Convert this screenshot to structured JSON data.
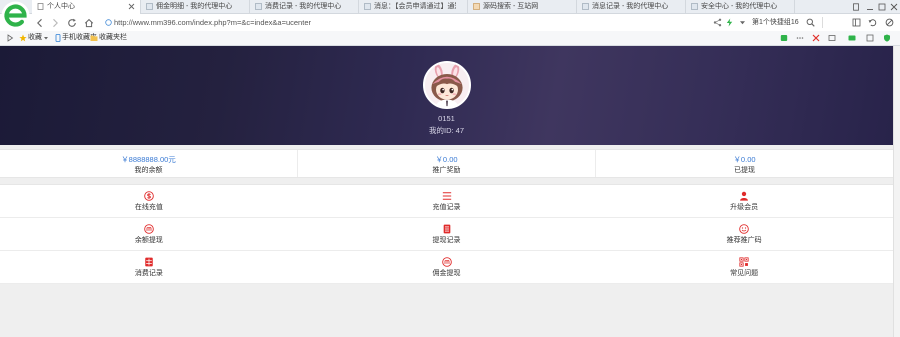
{
  "browser": {
    "tabs": [
      {
        "label": "个人中心",
        "favicon": "page-icon",
        "active": true
      },
      {
        "label": "佣金明细 - 我的代理中心",
        "favicon": "site-icon"
      },
      {
        "label": "消费记录 - 我的代理中心",
        "favicon": "site-icon"
      },
      {
        "label": "消息：【会员申请通过】通知：您",
        "favicon": "site-icon"
      },
      {
        "label": "源码搜索 - 互站网",
        "favicon": "site-icon"
      },
      {
        "label": "消息记录 - 我的代理中心",
        "favicon": "site-icon"
      },
      {
        "label": "安全中心 - 我的代理中心",
        "favicon": "site-icon"
      }
    ],
    "address": {
      "url": "http://www.mm396.com/index.php?m=&c=index&a=ucenter"
    },
    "search_hint": "第1个快捷组16",
    "bookmarks": {
      "favorites_label": "收藏",
      "mobile_label": "手机收藏夹",
      "bar_label": "收藏夹栏"
    }
  },
  "profile": {
    "avatar": "cartoon-girl-avatar",
    "nickname": "0151",
    "id_text": "我的ID: 47"
  },
  "stats": [
    {
      "value": "￥8888888.00元",
      "label": "我的余额"
    },
    {
      "value": "￥0.00",
      "label": "推广奖励"
    },
    {
      "value": "￥0.00",
      "label": "已提现"
    }
  ],
  "menu": [
    {
      "label": "在线充值",
      "icon": "dollar-circle-icon"
    },
    {
      "label": "充值记录",
      "icon": "list-icon"
    },
    {
      "label": "升级会员",
      "icon": "user-icon"
    },
    {
      "label": "余额提现",
      "icon": "m-circle-icon"
    },
    {
      "label": "提现记录",
      "icon": "document-icon"
    },
    {
      "label": "推荐推广码",
      "icon": "smile-icon"
    },
    {
      "label": "消费记录",
      "icon": "grid-document-icon"
    },
    {
      "label": "佣金提现",
      "icon": "m-circle-icon"
    },
    {
      "label": "常见问题",
      "icon": "qr-code-icon"
    }
  ],
  "colors": {
    "banner_dark": "#1b1a37",
    "banner_light": "#3f365f",
    "stat_value": "#3b7bd4",
    "menu_icon": "#e02b2b",
    "browser_logo": "#2fb34a"
  }
}
